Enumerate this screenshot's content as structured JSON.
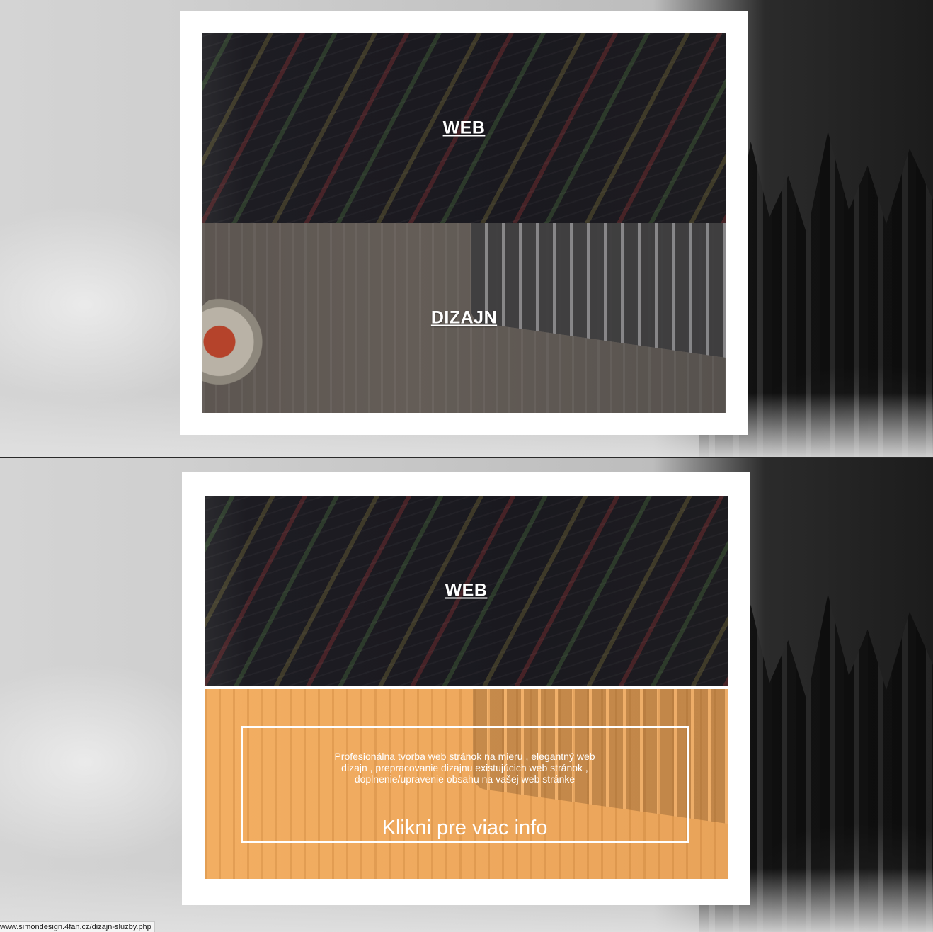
{
  "top_section": {
    "panels": [
      {
        "title": "WEB"
      },
      {
        "title": "DIZAJN"
      }
    ]
  },
  "bottom_section": {
    "panels": [
      {
        "title": "WEB"
      }
    ],
    "hover_panel": {
      "description": "Profesionálna tvorba web stránok na mieru , elegantný web dizajn , prepracovanie dizajnu existujúcich web stránok , doplnenie/upravenie obsahu na vašej web stránke",
      "link": "Klikni pre viac info"
    }
  },
  "status_bar": {
    "url": "www.simondesign.4fan.cz/dizajn-sluzby.php"
  },
  "colors": {
    "card_bg": "#ffffff",
    "hover_overlay": "#f2ae62"
  }
}
